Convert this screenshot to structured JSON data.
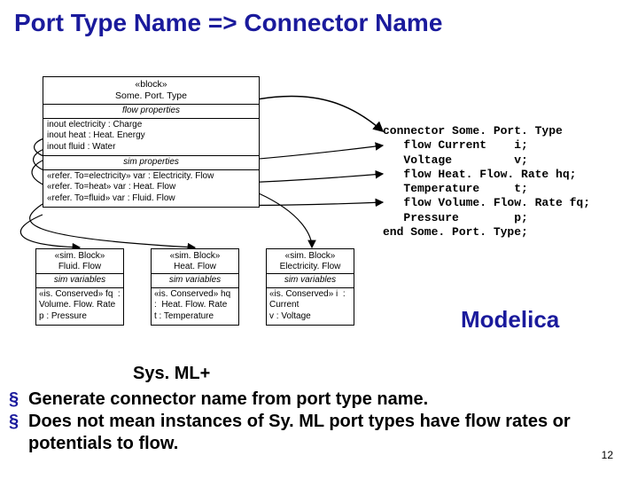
{
  "title": "Port Type Name => Connector Name",
  "mainBox": {
    "stereo": "«block»",
    "name": "Some. Port. Type",
    "flowHeader": "flow properties",
    "flow": [
      "inout electricity : Charge",
      "inout heat : Heat. Energy",
      "inout fluid : Water"
    ],
    "simHeader": "sim properties",
    "sim": [
      "«refer. To=electricity» var : Electricity. Flow",
      "«refer. To=heat» var : Heat. Flow",
      "«refer. To=fluid» var : Fluid. Flow"
    ]
  },
  "miniBoxes": [
    {
      "stereo": "«sim. Block»",
      "name": "Fluid. Flow",
      "sub": "sim variables",
      "body": "«is. Conserved» fq  :  Volume. Flow. Rate\np : Pressure"
    },
    {
      "stereo": "«sim. Block»",
      "name": "Heat. Flow",
      "sub": "sim variables",
      "body": "«is. Conserved» hq  :  Heat. Flow. Rate\nt : Temperature"
    },
    {
      "stereo": "«sim. Block»",
      "name": "Electricity. Flow",
      "sub": "sim variables",
      "body": "«is. Conserved» i  :  Current\nv : Voltage"
    }
  ],
  "code": "connector Some. Port. Type\n   flow Current    i;\n   Voltage         v;\n   flow Heat. Flow. Rate hq;\n   Temperature     t;\n   flow Volume. Flow. Rate fq;\n   Pressure        p;\nend Some. Port. Type;",
  "modelica": "Modelica",
  "sysmlplus": "Sys. ML+",
  "bullets": [
    "Generate connector name from port type name.",
    "Does not mean instances of Sy. ML port types have flow rates or potentials to flow."
  ],
  "pageNumber": "12"
}
